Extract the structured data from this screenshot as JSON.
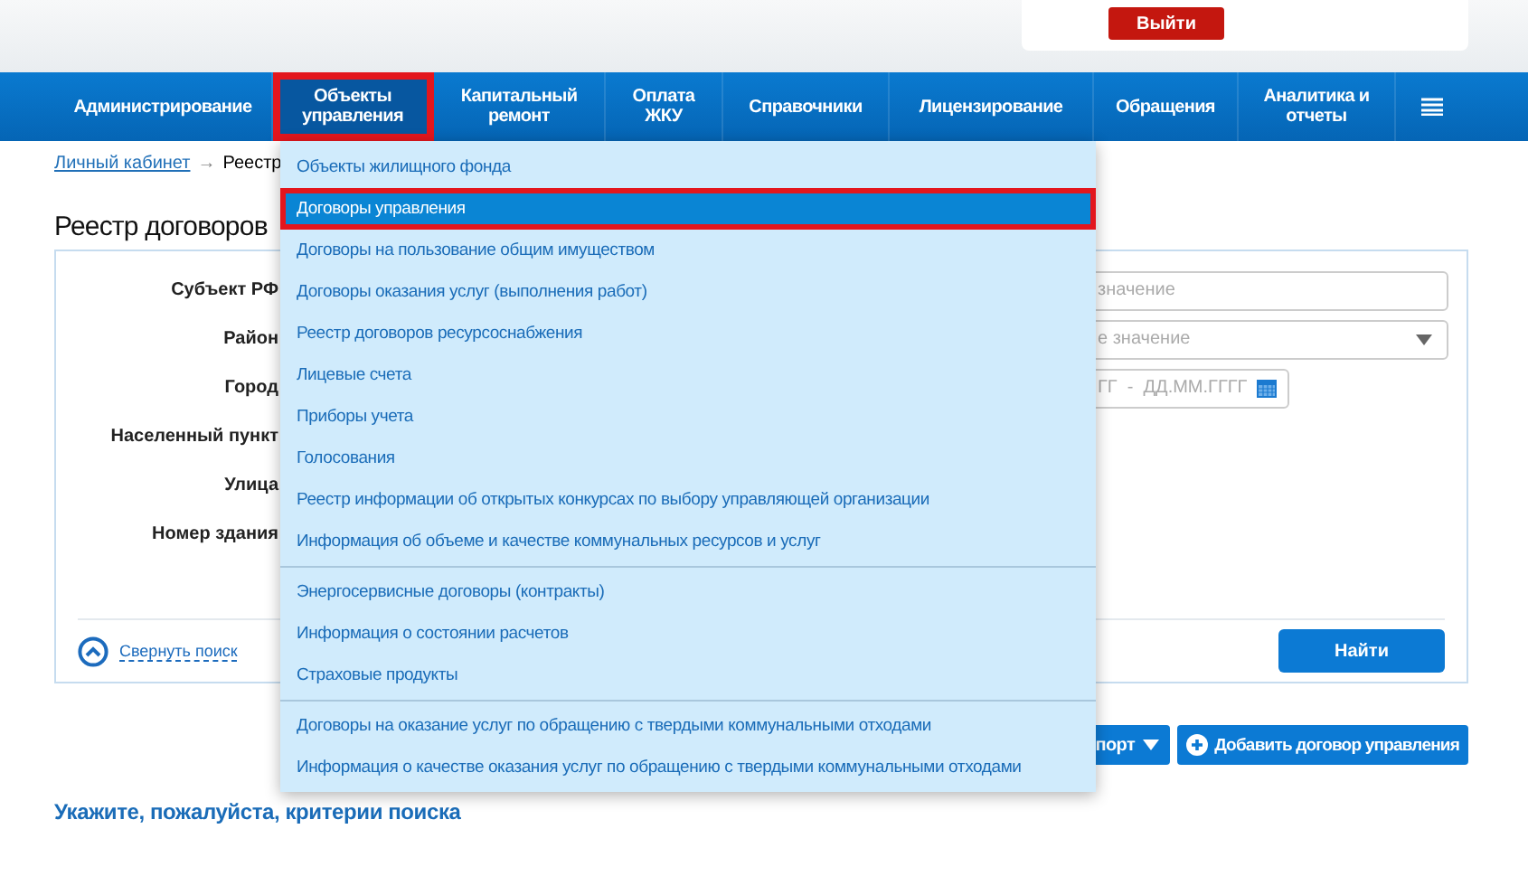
{
  "header": {
    "logout_button": "Выйти"
  },
  "nav": [
    {
      "label": "Администрирование",
      "selected": false,
      "highlighted": false
    },
    {
      "label": "Объекты управления",
      "selected": true,
      "highlighted": true
    },
    {
      "label": "Капитальный ремонт",
      "selected": false,
      "highlighted": false
    },
    {
      "label": "Оплата ЖКУ",
      "selected": false,
      "highlighted": false
    },
    {
      "label": "Справочники",
      "selected": false,
      "highlighted": false
    },
    {
      "label": "Лицензирование",
      "selected": false,
      "highlighted": false
    },
    {
      "label": "Обращения",
      "selected": false,
      "highlighted": false
    },
    {
      "label": "Аналитика и отчеты",
      "selected": false,
      "highlighted": false
    }
  ],
  "breadcrumb": {
    "link": "Личный кабинет",
    "separator": "→",
    "current": "Реестр"
  },
  "page_title": "Реестр договоров",
  "filters": [
    {
      "label": "Субъект РФ",
      "kind": "text",
      "placeholder": "значение"
    },
    {
      "label": "Район",
      "kind": "select",
      "placeholder": "е значение"
    },
    {
      "label": "Город",
      "kind": "date",
      "placeholder": "ГГ  -  ДД.ММ.ГГГГ"
    },
    {
      "label": "Населенный пункт",
      "kind": "none"
    },
    {
      "label": "Улица",
      "kind": "none"
    },
    {
      "label": "Номер здания",
      "kind": "none"
    }
  ],
  "collapse_link": "Свернуть поиск",
  "search_button": "Найти",
  "actions": [
    "порт",
    "Добавить договор управления"
  ],
  "hint": "Укажите, пожалуйста, критерии поиска",
  "dropdown": [
    [
      {
        "label": "Объекты жилищного фонда",
        "selected": false,
        "highlighted": false
      },
      {
        "label": "Договоры управления",
        "selected": true,
        "highlighted": true
      },
      {
        "label": "Договоры на пользование общим имуществом",
        "selected": false,
        "highlighted": false
      },
      {
        "label": "Договоры оказания услуг (выполнения работ)",
        "selected": false,
        "highlighted": false
      },
      {
        "label": "Реестр договоров ресурсоснабжения",
        "selected": false,
        "highlighted": false
      },
      {
        "label": "Лицевые счета",
        "selected": false,
        "highlighted": false
      },
      {
        "label": "Приборы учета",
        "selected": false,
        "highlighted": false
      },
      {
        "label": "Голосования",
        "selected": false,
        "highlighted": false
      },
      {
        "label": "Реестр информации об открытых конкурсах по выбору управляющей организации",
        "selected": false,
        "highlighted": false
      },
      {
        "label": "Информация об объеме и качестве коммунальных ресурсов и услуг",
        "selected": false,
        "highlighted": false
      }
    ],
    [
      {
        "label": "Энергосервисные договоры (контракты)",
        "selected": false,
        "highlighted": false
      },
      {
        "label": "Информация о состоянии расчетов",
        "selected": false,
        "highlighted": false
      },
      {
        "label": "Страховые продукты",
        "selected": false,
        "highlighted": false
      }
    ],
    [
      {
        "label": "Договоры на оказание услуг по обращению с твердыми коммунальными отходами",
        "selected": false,
        "highlighted": false
      },
      {
        "label": "Информация о качестве оказания услуг по обращению с твердыми коммунальными отходами",
        "selected": false,
        "highlighted": false
      }
    ]
  ]
}
